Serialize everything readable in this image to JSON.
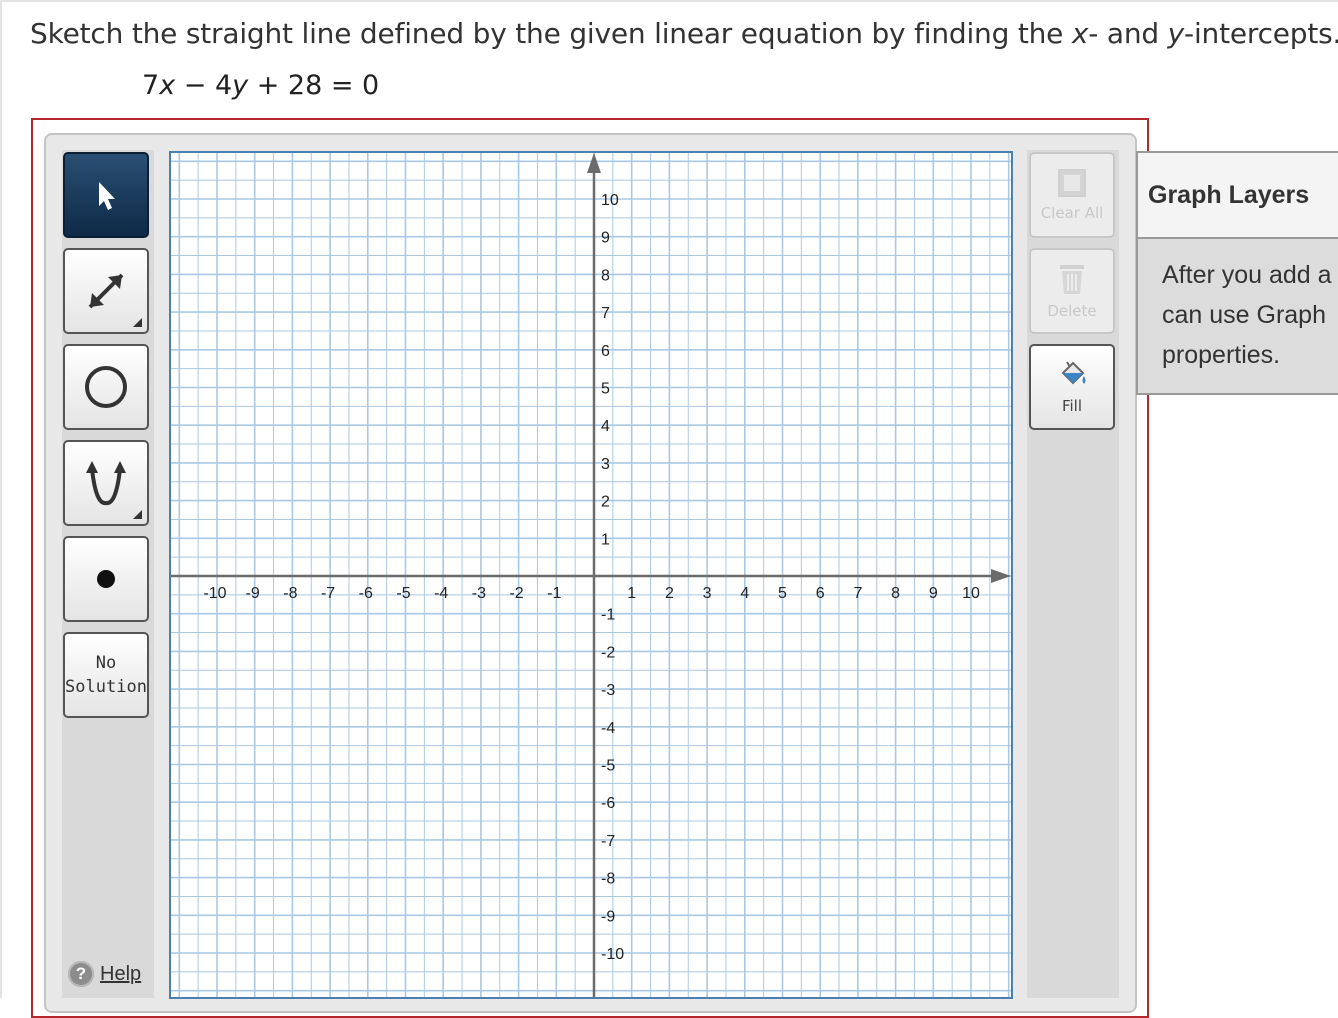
{
  "question": {
    "part1": "Sketch the straight line defined by the given linear equation by finding the ",
    "x": "x",
    "part2": "- and ",
    "y": "y",
    "part3": "-intercepts."
  },
  "equation": {
    "c1": "7",
    "v1": "x",
    "op1": " − 4",
    "v2": "y",
    "rest": " + 28 = 0"
  },
  "tools": {
    "pointer": "pointer-icon",
    "line": "line-icon",
    "circle": "circle-icon",
    "parabola": "parabola-icon",
    "point": "point-icon",
    "no_solution_line1": "No",
    "no_solution_line2": "Solution",
    "help_label": "Help"
  },
  "right_tools": {
    "clear_all": "Clear All",
    "delete": "Delete",
    "fill": "Fill"
  },
  "layers": {
    "title": "Graph Layers",
    "line1": "After you add a",
    "line2": "can use Graph",
    "line3": "properties."
  },
  "graph_axes": {
    "x_min": -10,
    "x_max": 10,
    "y_min": -10,
    "y_max": 10,
    "grid_step": 0.5,
    "x_ticks": [
      "-10",
      "-9",
      "-8",
      "-7",
      "-6",
      "-5",
      "-4",
      "-3",
      "-2",
      "-1",
      "1",
      "2",
      "3",
      "4",
      "5",
      "6",
      "7",
      "8",
      "9",
      "10"
    ],
    "y_ticks_pos": [
      "10",
      "9",
      "8",
      "7",
      "6",
      "5",
      "4",
      "3",
      "2",
      "1"
    ],
    "y_ticks_neg": [
      "-1",
      "-2",
      "-3",
      "-4",
      "-5",
      "-6",
      "-7",
      "-8",
      "-9",
      "-10"
    ]
  },
  "colors": {
    "grid": "#a9c8e4",
    "axis": "#6b6b6b",
    "frame": "#b3272d",
    "active_tool": "#1b3a5c"
  }
}
